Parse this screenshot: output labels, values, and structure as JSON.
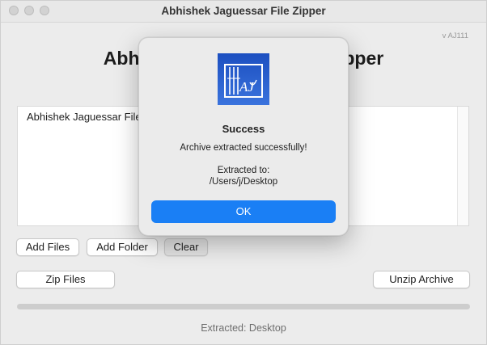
{
  "window": {
    "title": "Abhishek Jaguessar File Zipper"
  },
  "version": "v AJ111",
  "app_title": "Abhishek Jaguessar File Zipper",
  "file_list": {
    "items": [
      "Abhishek Jaguessar File Zipper"
    ]
  },
  "buttons": {
    "add_files": "Add Files",
    "add_folder": "Add Folder",
    "clear": "Clear",
    "zip_files": "Zip Files",
    "unzip_archive": "Unzip Archive"
  },
  "progress": {
    "value": 0
  },
  "status": "Extracted: Desktop",
  "dialog": {
    "icon": "app-zipper-icon",
    "title": "Success",
    "message": "Archive extracted successfully!",
    "extracted_label": "Extracted to:",
    "extracted_path": "/Users/j/Desktop",
    "ok_label": "OK"
  },
  "colors": {
    "accent": "#1a7ff5",
    "icon_blue": "#2a5cc8"
  }
}
